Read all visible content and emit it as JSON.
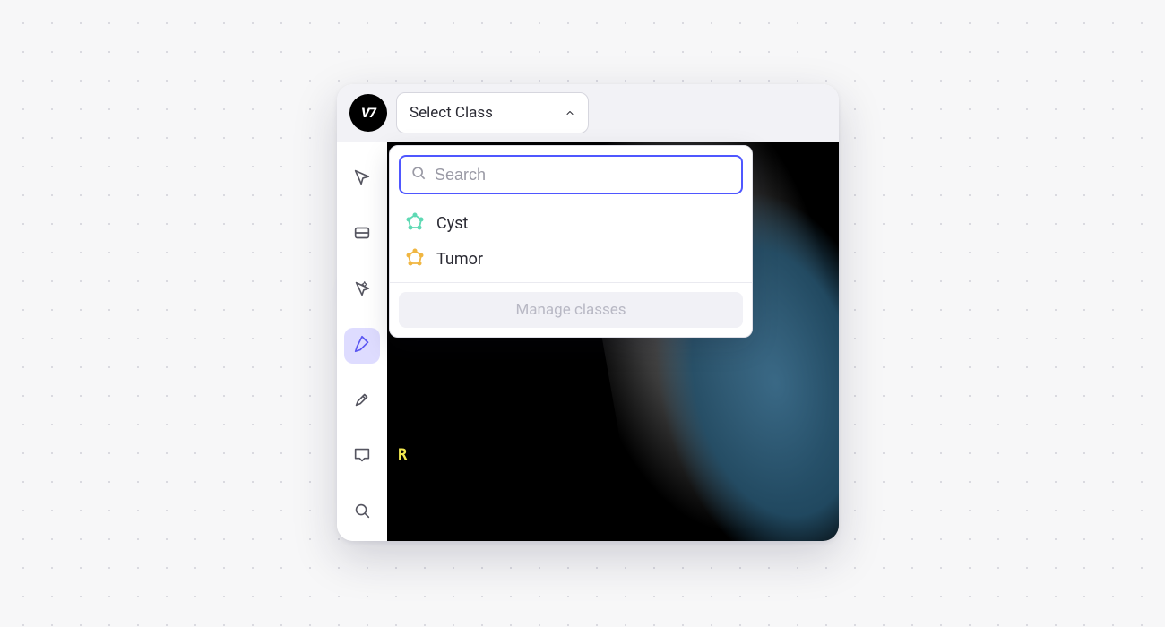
{
  "app": {
    "brand": "V7"
  },
  "header": {
    "select_class_label": "Select Class"
  },
  "dropdown": {
    "search_placeholder": "Search",
    "classes": [
      {
        "label": "Cyst",
        "color": "#5fd9b4"
      },
      {
        "label": "Tumor",
        "color": "#f0b642"
      }
    ],
    "manage_label": "Manage classes"
  },
  "toolbar": {
    "tools": [
      {
        "id": "select",
        "active": false
      },
      {
        "id": "bbox",
        "active": false
      },
      {
        "id": "auto",
        "active": false
      },
      {
        "id": "polygon",
        "active": true
      },
      {
        "id": "brush",
        "active": false
      },
      {
        "id": "comment",
        "active": false
      },
      {
        "id": "zoom",
        "active": false
      }
    ]
  },
  "canvas": {
    "marker": "R"
  },
  "colors": {
    "accent": "#4f57ff",
    "tool_active_bg": "#dedcff",
    "tool_active_fg": "#5b57f2"
  }
}
